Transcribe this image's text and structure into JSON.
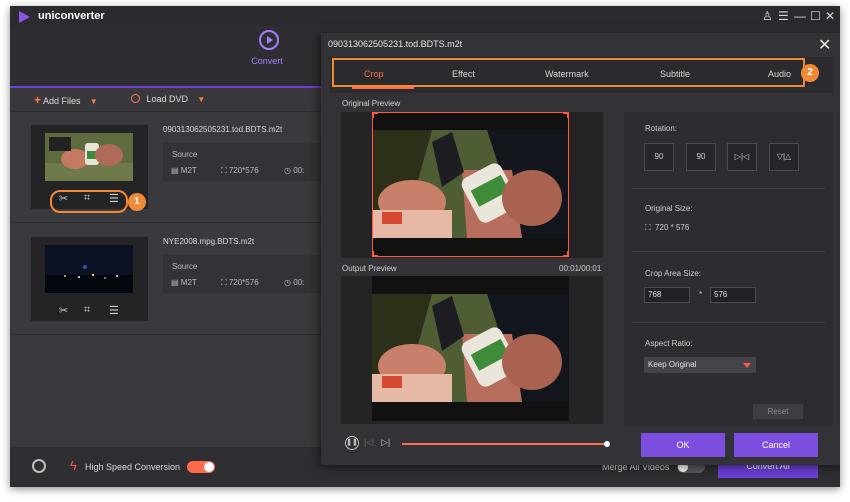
{
  "app": {
    "title": "uniconverter"
  },
  "window_controls": {
    "user": "♙",
    "menu": "☰",
    "minimize": "—",
    "maximize": "☐",
    "close": "✕"
  },
  "topbar": {
    "active_tab": "Convert"
  },
  "toolbar": {
    "add_files": "Add Files",
    "load_dvd": "Load DVD"
  },
  "files": [
    {
      "name": "090313062505231.tod.BDTS.m2t",
      "source_label": "Source",
      "format": "M2T",
      "resolution": "720*576",
      "duration": "00:"
    },
    {
      "name": "NYE2008.mpg.BDTS.m2t",
      "source_label": "Source",
      "format": "M2T",
      "resolution": "720*576",
      "duration": "00:"
    }
  ],
  "callouts": {
    "first": "1",
    "second": "2"
  },
  "bottombar": {
    "high_speed": "High Speed Conversion",
    "high_speed_on": true,
    "merge_all": "Merge All Videos",
    "merge_on": false,
    "convert_all": "Convert All"
  },
  "dialog": {
    "title": "090313062505231.tod.BDTS.m2t",
    "tabs": [
      "Crop",
      "Effect",
      "Watermark",
      "Subtitle",
      "Audio"
    ],
    "active_tab": "Crop",
    "original_preview": "Original Preview",
    "output_preview": "Output Preview",
    "time": "00:01/00:01",
    "rotation_label": "Rotation:",
    "rotation_buttons": [
      "90",
      "90",
      "▷|◁",
      "▽|△"
    ],
    "original_size_label": "Original Size:",
    "original_size": "720 * 576",
    "crop_area_label": "Crop Area Size:",
    "crop_width": "768",
    "crop_separator": "*",
    "crop_height": "576",
    "aspect_label": "Aspect Ratio:",
    "aspect_value": "Keep Original",
    "reset": "Reset",
    "ok": "OK",
    "cancel": "Cancel",
    "playback_progress": 1.0
  },
  "colors": {
    "accent": "#6b40d6",
    "highlight": "#ff6a4a",
    "callout": "#f08a36",
    "button": "#7b4ee0"
  }
}
